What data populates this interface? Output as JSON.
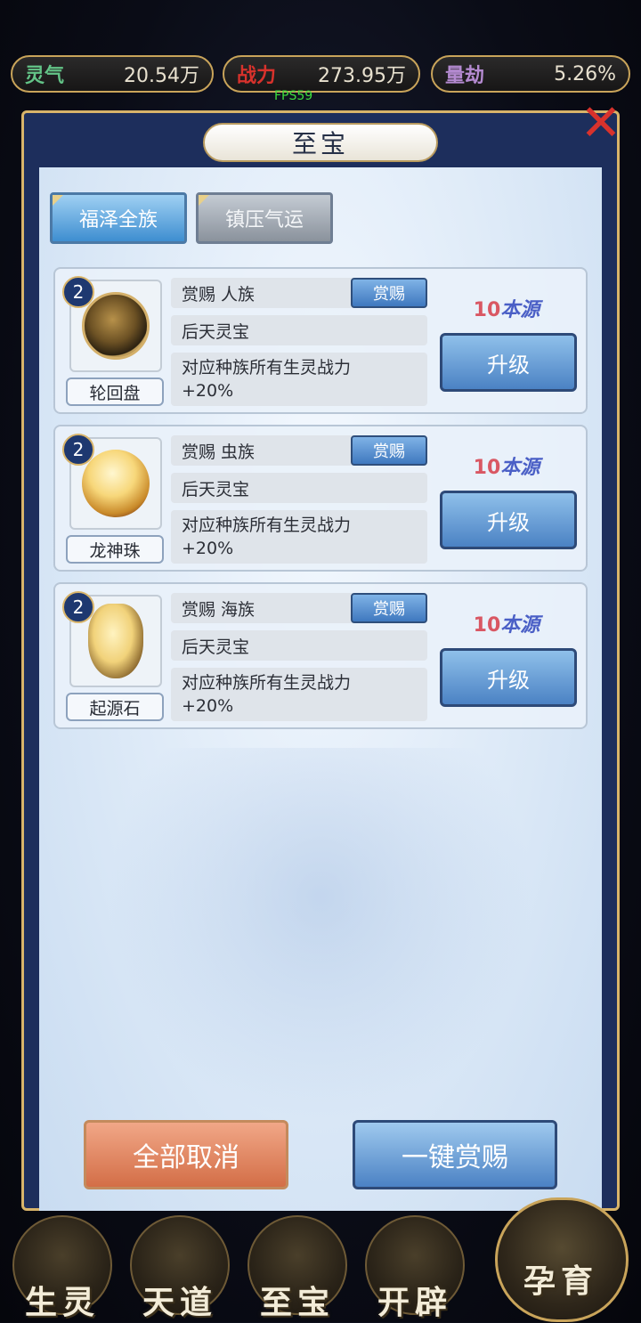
{
  "stats": [
    {
      "label": "灵气",
      "value": "20.54万",
      "color": "#63c487"
    },
    {
      "label": "战力",
      "value": "273.95万",
      "color": "#d8322c"
    },
    {
      "label": "量劫",
      "value": "5.26%",
      "color": "#b48ad0"
    }
  ],
  "fps": "FPS59",
  "panel": {
    "title": "至宝"
  },
  "tabs": [
    {
      "label": "福泽全族",
      "active": true
    },
    {
      "label": "镇压气运",
      "active": false
    }
  ],
  "items": [
    {
      "level": "2",
      "name": "轮回盘",
      "icon": "wheel-disc-icon",
      "reward_line": "赏赐  人族",
      "reward_button": "赏赐",
      "type": "后天灵宝",
      "effect": "对应种族所有生灵战力+20%",
      "cost_num": "10",
      "cost_unit": "本源",
      "upgrade_label": "升级"
    },
    {
      "level": "2",
      "name": "龙神珠",
      "icon": "dragon-pearl-icon",
      "reward_line": "赏赐  虫族",
      "reward_button": "赏赐",
      "type": "后天灵宝",
      "effect": "对应种族所有生灵战力+20%",
      "cost_num": "10",
      "cost_unit": "本源",
      "upgrade_label": "升级"
    },
    {
      "level": "2",
      "name": "起源石",
      "icon": "origin-stone-icon",
      "reward_line": "赏赐  海族",
      "reward_button": "赏赐",
      "type": "后天灵宝",
      "effect": "对应种族所有生灵战力+20%",
      "cost_num": "10",
      "cost_unit": "本源",
      "upgrade_label": "升级"
    }
  ],
  "actions": {
    "cancel_all": "全部取消",
    "reward_all": "一键赏赐"
  },
  "nav": [
    "生灵",
    "天道",
    "至宝",
    "开辟",
    "孕育"
  ]
}
